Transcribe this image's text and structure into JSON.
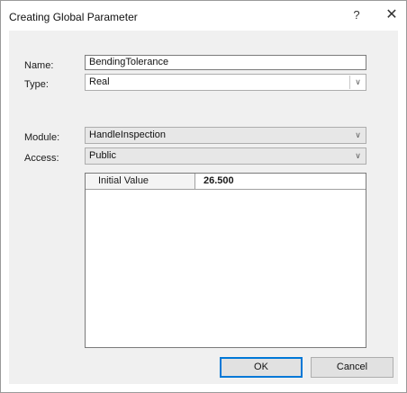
{
  "window": {
    "title": "Creating Global Parameter",
    "help_glyph": "?",
    "close_glyph": "✕"
  },
  "form": {
    "name_label": "Name:",
    "name_value": "BendingTolerance",
    "type_label": "Type:",
    "type_value": "Real",
    "module_label": "Module:",
    "module_value": "HandleInspection",
    "access_label": "Access:",
    "access_value": "Public",
    "dropdown_glyph": "∨"
  },
  "grid": {
    "rows": [
      {
        "name": "Initial Value",
        "value": "26.500"
      }
    ]
  },
  "buttons": {
    "ok_label": "OK",
    "cancel_label": "Cancel"
  },
  "colors": {
    "default_button_border": "#0078d7",
    "client_background": "#f0f0f0"
  },
  "icons": {
    "help": "question-mark-icon",
    "close": "close-icon",
    "dropdown": "chevron-down-icon"
  }
}
